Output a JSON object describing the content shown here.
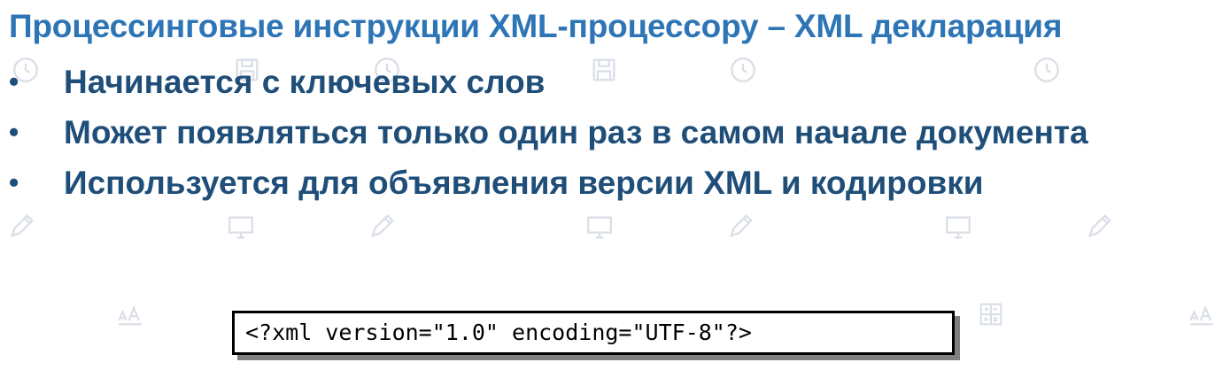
{
  "slide": {
    "title": "Процессинговые инструкции  XML-процессору – XML декларация",
    "bullets": [
      {
        "marker": "•",
        "text": "Начинается с ключевых слов"
      },
      {
        "marker": "•",
        "text": "Может появляться только один раз в самом начале документа"
      },
      {
        "marker": "•",
        "text": "Используется для объявления версии XML и кодировки"
      }
    ],
    "code": "<?xml version=\"1.0\" encoding=\"UTF-8\"?>"
  },
  "colors": {
    "title": "#2e75b6",
    "bullets": "#1f4e79",
    "pattern": "#d9dee7"
  },
  "background_icons": [
    "clock-icon",
    "floppy-icon",
    "pencil-icon",
    "monitor-icon",
    "font-size-icon",
    "calculator-icon"
  ]
}
